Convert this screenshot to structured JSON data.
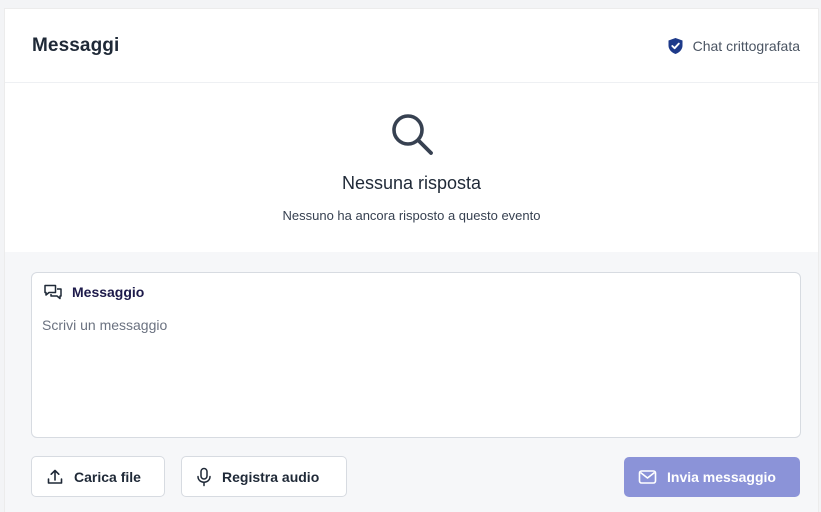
{
  "header": {
    "title": "Messaggi",
    "encryption_label": "Chat crittografata"
  },
  "empty_state": {
    "icon": "search-icon",
    "title": "Nessuna risposta",
    "subtitle": "Nessuno ha ancora risposto a questo evento"
  },
  "composer": {
    "label": "Messaggio",
    "value": "",
    "placeholder": "Scrivi un messaggio",
    "upload_label": "Carica file",
    "audio_label": "Registra audio",
    "send_label": "Invia messaggio"
  },
  "colors": {
    "shield": "#1e3a8a",
    "send_button": "#8b93d8"
  }
}
